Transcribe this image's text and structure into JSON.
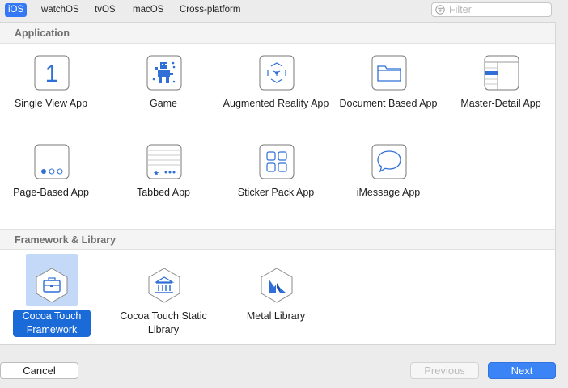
{
  "platform_tabs": [
    "iOS",
    "watchOS",
    "tvOS",
    "macOS",
    "Cross-platform"
  ],
  "selected_platform": "iOS",
  "filter": {
    "placeholder": "Filter"
  },
  "sections": {
    "application": {
      "title": "Application",
      "templates": [
        {
          "label": "Single View App",
          "icon": "single-view-icon"
        },
        {
          "label": "Game",
          "icon": "game-icon"
        },
        {
          "label": "Augmented Reality App",
          "icon": "augmented-reality-icon"
        },
        {
          "label": "Document Based App",
          "icon": "document-based-icon"
        },
        {
          "label": "Master-Detail App",
          "icon": "master-detail-icon"
        },
        {
          "label": "Page-Based App",
          "icon": "page-based-icon"
        },
        {
          "label": "Tabbed App",
          "icon": "tabbed-icon"
        },
        {
          "label": "Sticker Pack App",
          "icon": "sticker-pack-icon"
        },
        {
          "label": "iMessage App",
          "icon": "imessage-icon"
        }
      ]
    },
    "framework": {
      "title": "Framework & Library",
      "templates": [
        {
          "label": "Cocoa Touch Framework",
          "icon": "cocoa-touch-framework-icon",
          "selected": true
        },
        {
          "label": "Cocoa Touch Static Library",
          "icon": "static-library-icon"
        },
        {
          "label": "Metal Library",
          "icon": "metal-library-icon"
        }
      ]
    }
  },
  "buttons": {
    "cancel": "Cancel",
    "previous": "Previous",
    "next": "Next"
  },
  "colors": {
    "accent": "#3478f6",
    "selection": "#1a6ad8",
    "icon_blue": "#2f6fd6"
  }
}
